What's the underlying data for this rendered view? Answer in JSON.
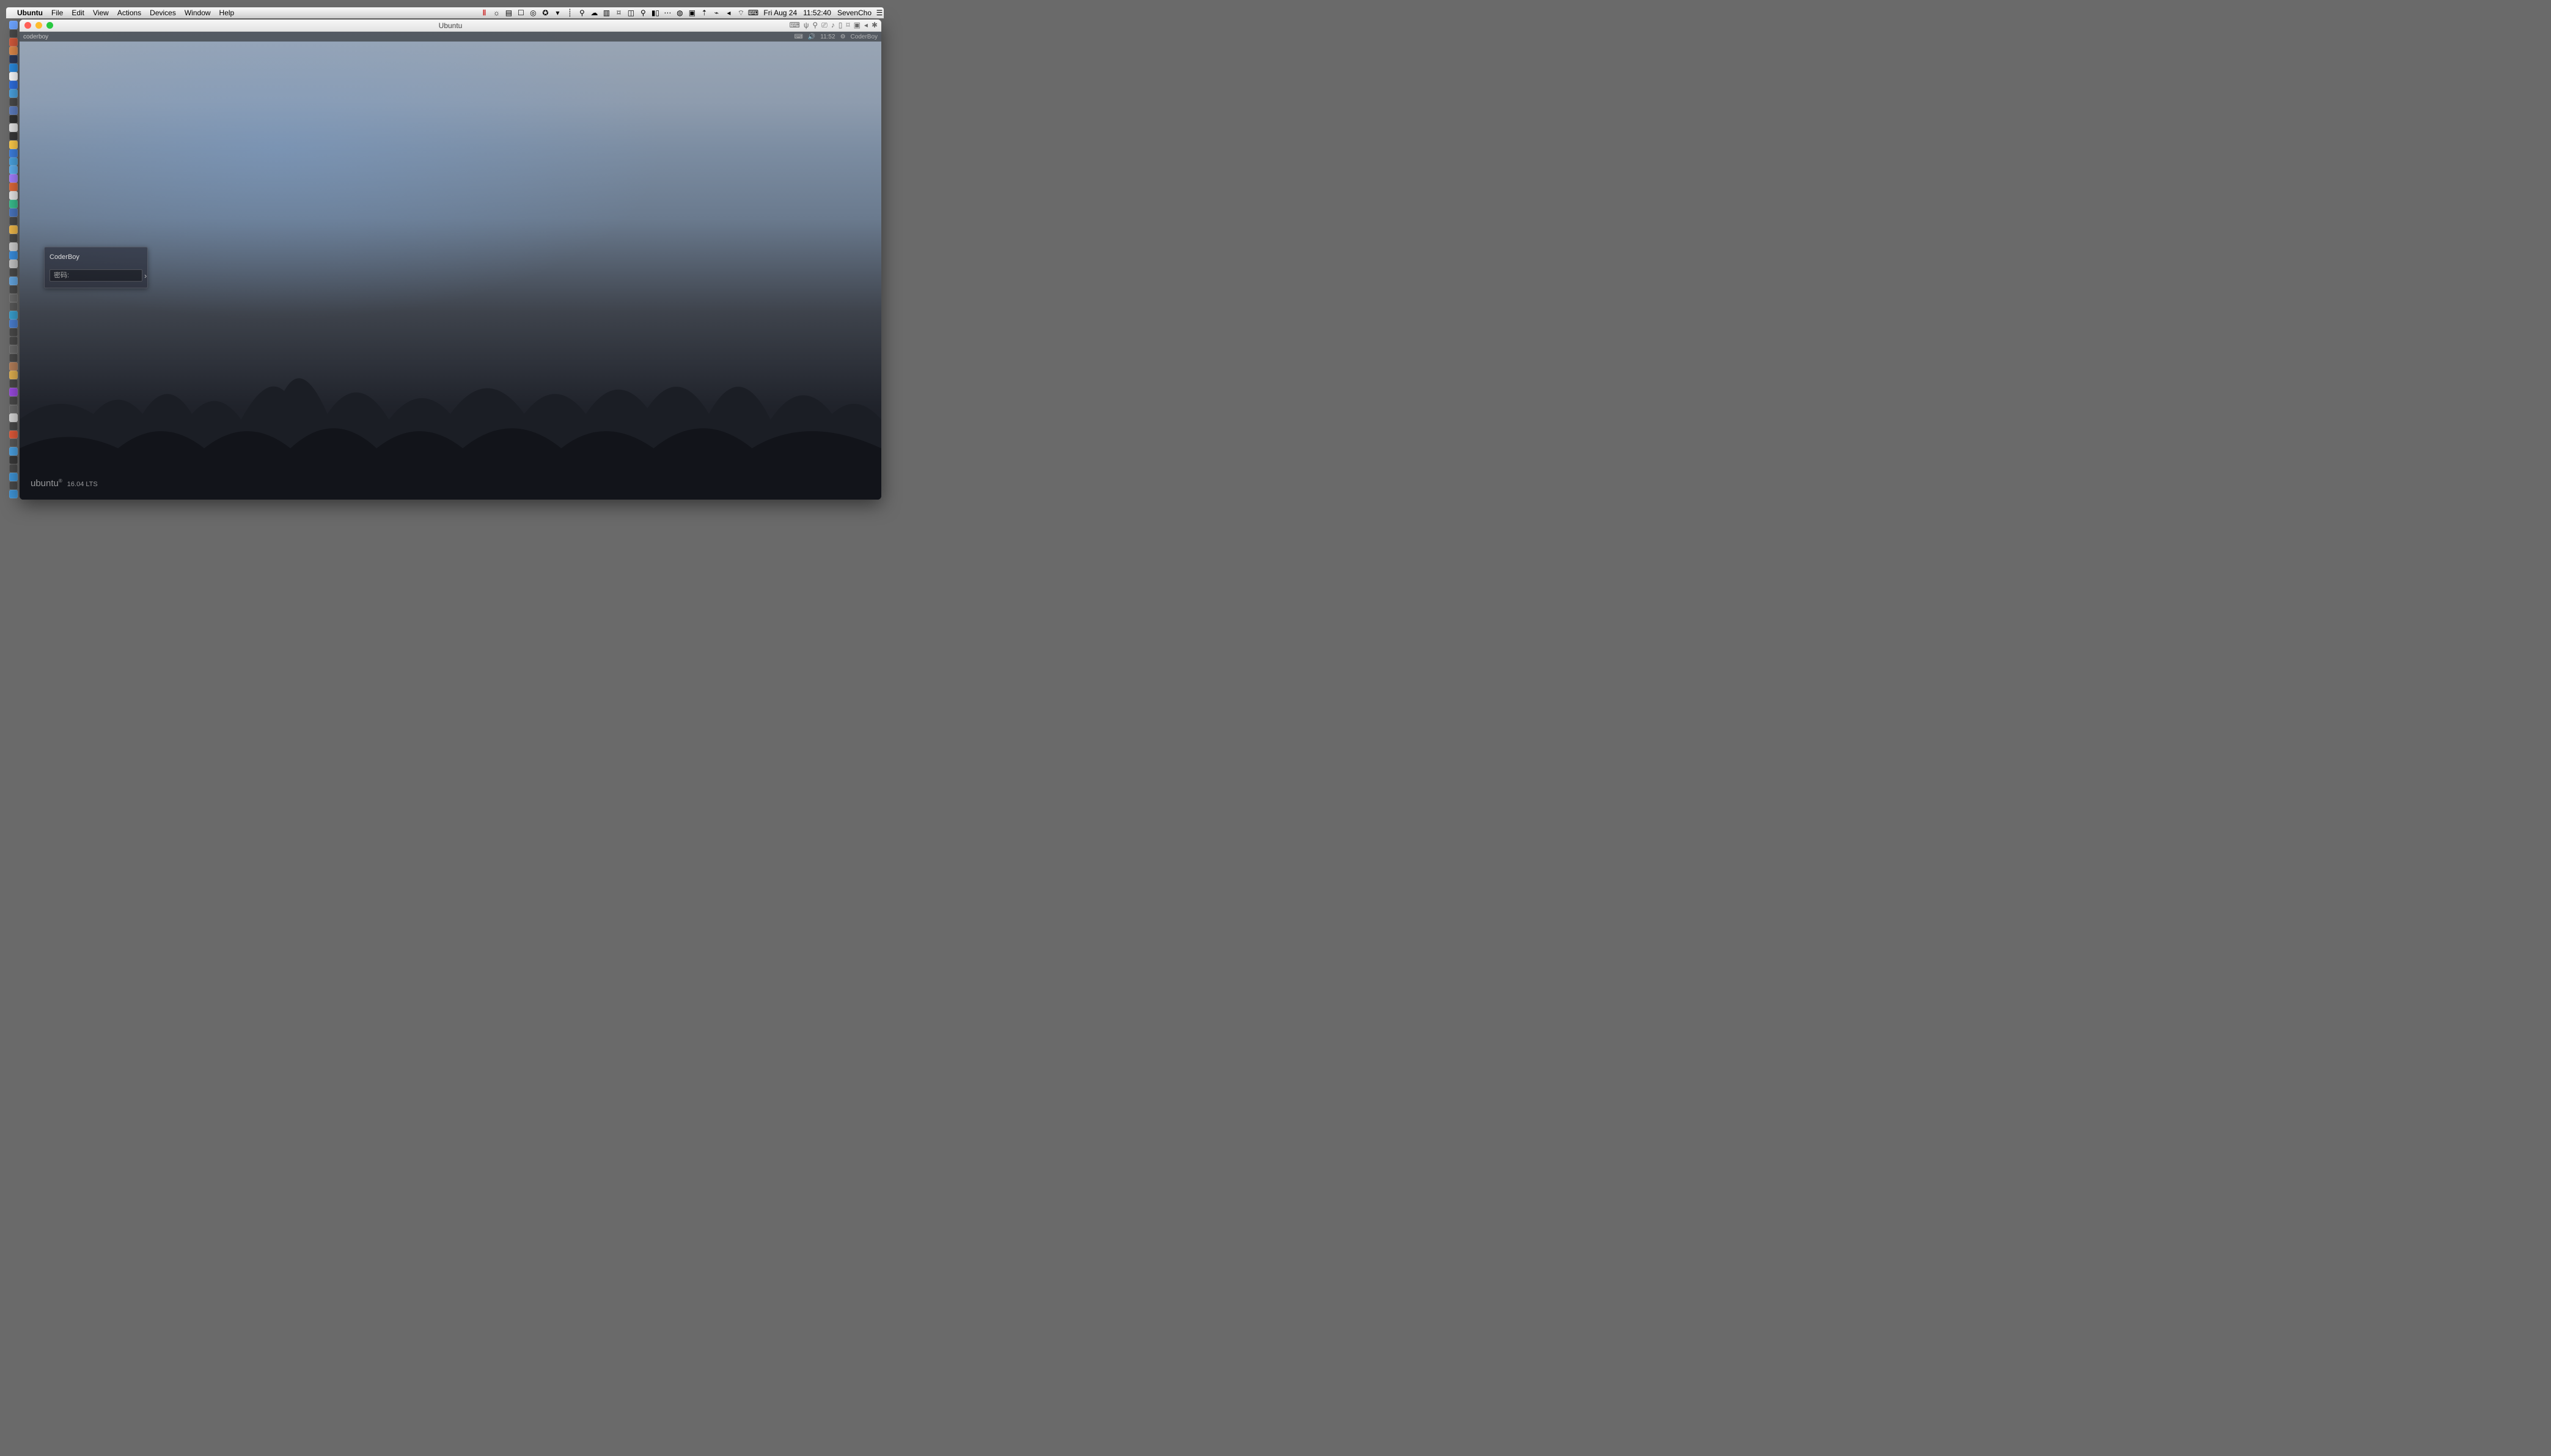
{
  "mac_menubar": {
    "apple_glyph": "",
    "app_name": "Ubuntu",
    "menus": [
      "File",
      "Edit",
      "View",
      "Actions",
      "Devices",
      "Window",
      "Help"
    ],
    "right_date": "Fri Aug 24",
    "right_time": "11:52:40",
    "right_user": "SevenCho",
    "status_icons": [
      "pause",
      "globe",
      "image",
      "monitor",
      "camera",
      "safari",
      "dropdown",
      "divider",
      "pin",
      "cloud",
      "menu",
      "display",
      "window",
      "search",
      "battery",
      "wifi-alt",
      "dots",
      "signal",
      "volume",
      "wifi",
      "input",
      "hamburger"
    ]
  },
  "vm_window": {
    "title": "Ubuntu",
    "toolbar_icons": [
      "keyboard",
      "usb",
      "search",
      "screenshot",
      "sound",
      "tablet",
      "display",
      "folder",
      "back",
      "gear"
    ]
  },
  "ubuntu_topbar": {
    "left_label": "coderboy",
    "right_time": "11:52",
    "right_user": "CoderBoy",
    "right_icons": [
      "keyboard-icon",
      "volume-icon",
      "clock-text",
      "gear-icon",
      "user-text"
    ]
  },
  "login": {
    "username": "CoderBoy",
    "password_placeholder": "密码:",
    "arrow_glyph": "›"
  },
  "branding": {
    "logo_text": "ubuntu",
    "logo_reg": "®",
    "version": "16.04 LTS"
  },
  "dock_colors": [
    "#6ca3ff",
    "#4a4a4a",
    "#d55b3c",
    "#e08a4a",
    "#2d3a5a",
    "#2a8be0",
    "#ffffff",
    "#2f6fe0",
    "#4aa3e0",
    "#4a4a4a",
    "#5e7ec0",
    "#333333",
    "#e8e8e8",
    "#3a3a3a",
    "#ffcc4a",
    "#3d7fe0",
    "#4aa3e0",
    "#5fb0f0",
    "#a57fff",
    "#df6a3a",
    "#e8e8e8",
    "#3abf8f",
    "#4a76c0",
    "#4a4a4a",
    "#f0b94a",
    "#4a4a4a",
    "#d0d0d0",
    "#3a8fe0",
    "#c6c6c6",
    "#4a4a4a",
    "#65a6e0",
    "#4a4a4a",
    "#6a6a6a",
    "#5a5a5a",
    "#3aa0d0",
    "#4a7fd0",
    "#4a4a4a",
    "#4a4a4a",
    "#6a6a6a",
    "#4a4a4a",
    "#b57f5a",
    "#e0b050",
    "#4a4a4a",
    "#9a4ae0",
    "#4a4a4a",
    "#6a6a6a",
    "#d8d8d8",
    "#4a4a4a",
    "#e05a3a",
    "#5a5a5a",
    "#4aa0e0",
    "#3a3a3a",
    "#4a4a4a",
    "#3f94d6",
    "#4a4a4a",
    "#3f94d6"
  ]
}
